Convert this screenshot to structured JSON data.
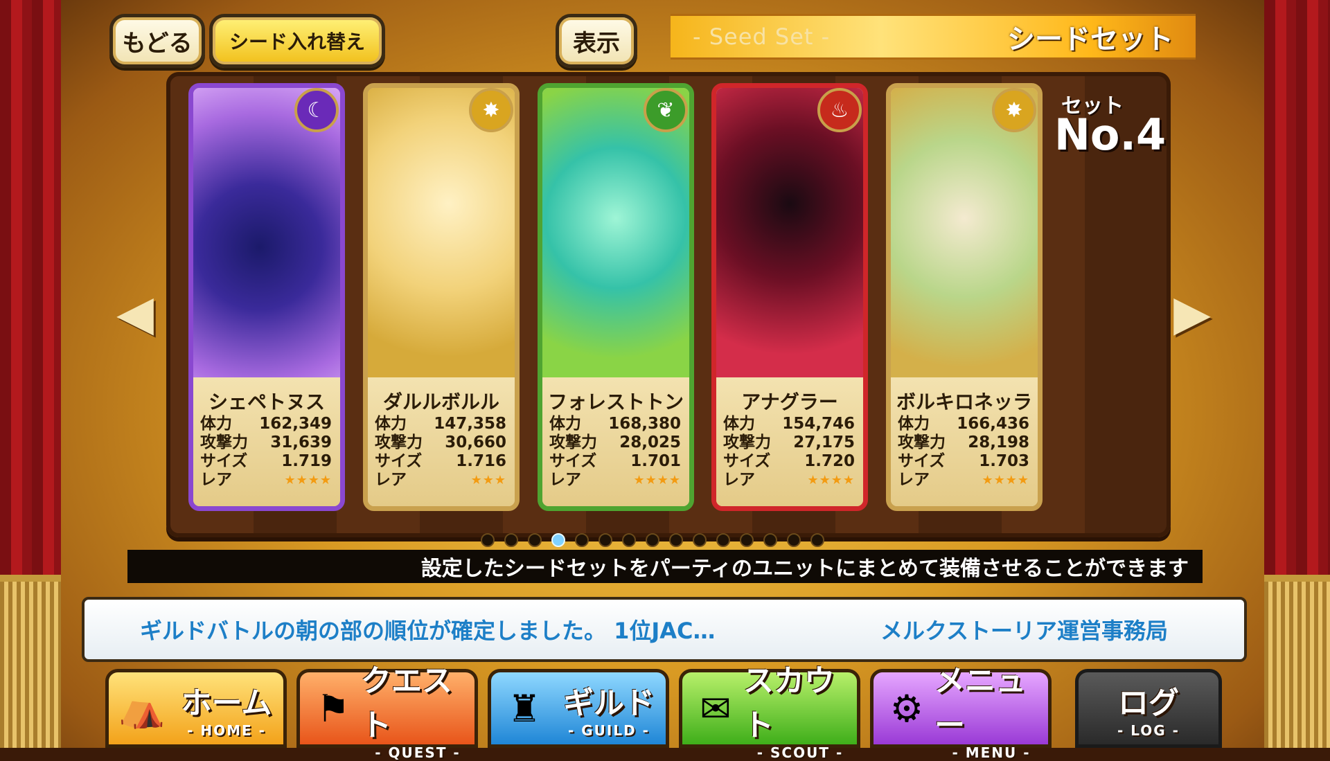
{
  "header": {
    "back_label": "もどる",
    "swap_label": "シード入れ替え",
    "view_label": "表示",
    "title_sub": "- Seed Set -",
    "title_main": "シードセット"
  },
  "set": {
    "label": "セット",
    "number": "No.4"
  },
  "cards": [
    {
      "name": "シェペトヌス",
      "hp": "162,349",
      "atk": "31,639",
      "size": "1.719",
      "rarity": "★★★★",
      "element": "moon-icon"
    },
    {
      "name": "ダルルボルル",
      "hp": "147,358",
      "atk": "30,660",
      "size": "1.716",
      "rarity": "★★★",
      "element": "sun-icon"
    },
    {
      "name": "フォレストトン",
      "hp": "168,380",
      "atk": "28,025",
      "size": "1.701",
      "rarity": "★★★★",
      "element": "leaf-icon"
    },
    {
      "name": "アナグラー",
      "hp": "154,746",
      "atk": "27,175",
      "size": "1.720",
      "rarity": "★★★★",
      "element": "fire-icon"
    },
    {
      "name": "ボルキロネッラ",
      "hp": "166,436",
      "atk": "28,198",
      "size": "1.703",
      "rarity": "★★★★",
      "element": "sun-icon"
    }
  ],
  "stat_labels": {
    "hp": "体力",
    "atk": "攻撃力",
    "size": "サイズ",
    "rarity": "レア"
  },
  "pagination": {
    "total": 15,
    "active": 4
  },
  "hint_text": "設定したシードセットをパーティのユニットにまとめて装備させることができます",
  "news": {
    "message": "ギルドバトルの朝の部の順位が確定しました。 1位JAC…",
    "sender": "メルクストーリア運営事務局"
  },
  "nav": [
    {
      "jp": "ホーム",
      "en": "- HOME -"
    },
    {
      "jp": "クエスト",
      "en": "- QUEST -"
    },
    {
      "jp": "ギルド",
      "en": "- GUILD -"
    },
    {
      "jp": "スカウト",
      "en": "- SCOUT -"
    },
    {
      "jp": "メニュー",
      "en": "- MENU -"
    },
    {
      "jp": "ログ",
      "en": "- LOG -"
    }
  ]
}
